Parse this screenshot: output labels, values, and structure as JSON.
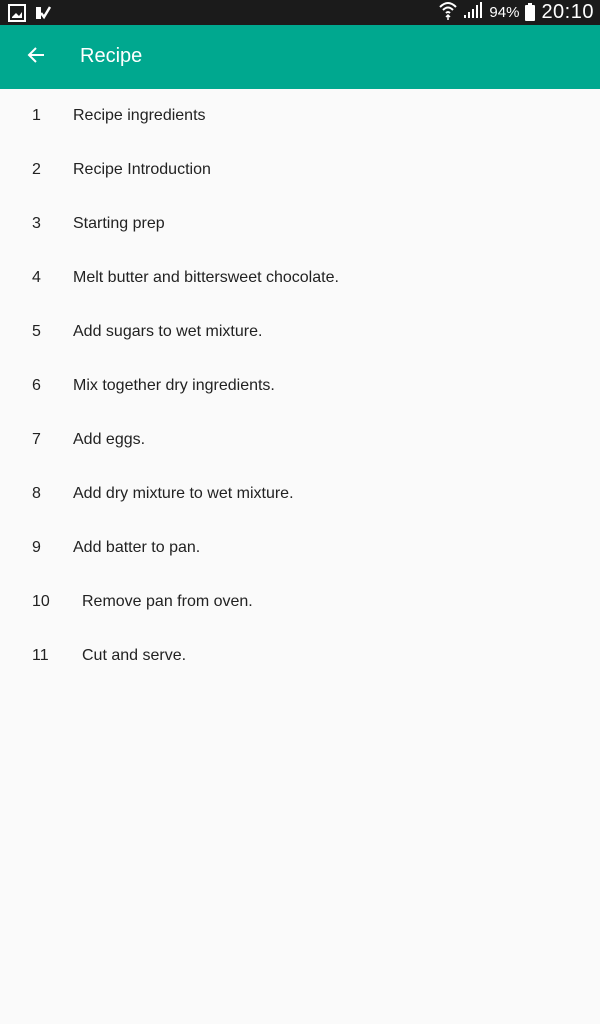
{
  "status_bar": {
    "battery": "94%",
    "time": "20:10",
    "icons": [
      "gallery-icon",
      "check-notification-icon",
      "wifi-icon",
      "signal-icon",
      "battery-icon"
    ]
  },
  "app_bar": {
    "title": "Recipe",
    "back_icon": "arrow-back-icon",
    "color": "#00a88f"
  },
  "steps": [
    {
      "num": "1",
      "label": "Recipe ingredients"
    },
    {
      "num": "2",
      "label": "Recipe Introduction"
    },
    {
      "num": "3",
      "label": "Starting prep"
    },
    {
      "num": "4",
      "label": "Melt butter and bittersweet chocolate."
    },
    {
      "num": "5",
      "label": "Add sugars to wet mixture."
    },
    {
      "num": "6",
      "label": "Mix together dry ingredients."
    },
    {
      "num": "7",
      "label": "Add eggs."
    },
    {
      "num": "8",
      "label": "Add dry mixture to wet mixture."
    },
    {
      "num": "9",
      "label": "Add batter to pan."
    },
    {
      "num": "10",
      "label": "Remove pan from oven."
    },
    {
      "num": "11",
      "label": "Cut and serve."
    }
  ]
}
